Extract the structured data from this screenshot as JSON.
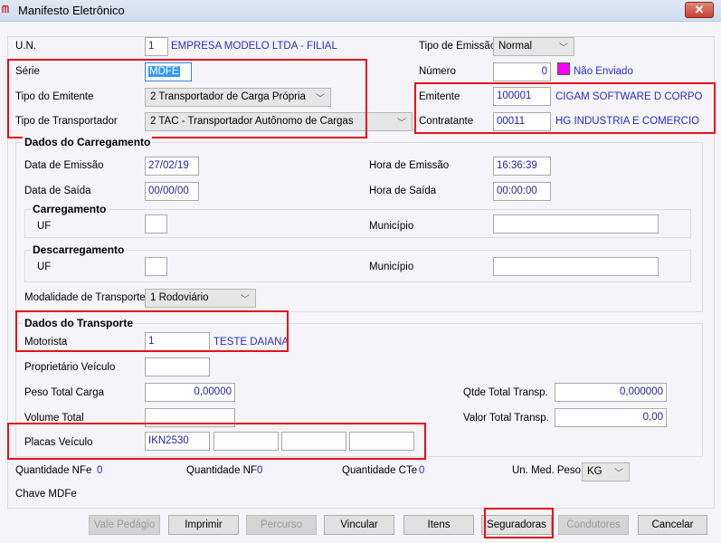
{
  "window": {
    "title": "Manifesto Eletrônico",
    "close": "✕"
  },
  "un": {
    "label": "U.N.",
    "value": "1",
    "name": "EMPRESA MODELO LTDA - FILIAL"
  },
  "serie": {
    "label": "Série",
    "value": "MDFE"
  },
  "tipo_emitente": {
    "label": "Tipo do Emitente",
    "value": "2 Transportador de Carga Própria"
  },
  "tipo_transportador": {
    "label": "Tipo de Transportador",
    "value": "2 TAC - Transportador Autônomo de Cargas"
  },
  "tipo_emissao": {
    "label": "Tipo de Emissão",
    "value": "Normal"
  },
  "numero": {
    "label": "Número",
    "value": "0",
    "status": "Não Enviado",
    "status_color": "#ff00ff"
  },
  "emitente": {
    "label": "Emitente",
    "code": "100001",
    "name": "CIGAM SOFTWARE D CORPORAT."
  },
  "contratante": {
    "label": "Contratante",
    "code": "00011",
    "name": "HG INDUSTRIA E COMERCIO DE C"
  },
  "carregamento": {
    "title": "Dados do Carregamento",
    "data_emissao_label": "Data de Emissão",
    "data_emissao": "27/02/19",
    "hora_emissao_label": "Hora de Emissão",
    "hora_emissao": "16:36:39",
    "data_saida_label": "Data de Saída",
    "data_saida": "00/00/00",
    "hora_saida_label": "Hora de Saída",
    "hora_saida": "00:00:00",
    "carreg": {
      "title": "Carregamento",
      "uf_label": "UF",
      "uf": "",
      "municipio_label": "Município",
      "municipio": ""
    },
    "descarreg": {
      "title": "Descarregamento",
      "uf_label": "UF",
      "uf": "",
      "municipio_label": "Município",
      "municipio": ""
    },
    "modalidade_label": "Modalidade de Transporte",
    "modalidade": "1 Rodoviário"
  },
  "transporte": {
    "title": "Dados do Transporte",
    "motorista_label": "Motorista",
    "motorista_code": "1",
    "motorista_name": "TESTE DAIANA",
    "proprietario_label": "Proprietário Veículo",
    "proprietario": "",
    "peso_label": "Peso Total Carga",
    "peso": "0,00000",
    "qtde_label": "Qtde Total Transp.",
    "qtde": "0,000000",
    "volume_label": "Volume Total",
    "volume": "",
    "valor_label": "Valor Total Transp.",
    "valor": "0,00",
    "placas_label": "Placas Veículo",
    "placas": [
      "IKN2530",
      "",
      "",
      ""
    ]
  },
  "totais": {
    "nfe_label": "Quantidade NFe",
    "nfe": "0",
    "nf_label": "Quantidade NF",
    "nf": "0",
    "cte_label": "Quantidade CTe",
    "cte": "0",
    "unmed_label": "Un. Med. Peso",
    "unmed": "KG",
    "chave_label": "Chave MDFe"
  },
  "buttons": {
    "vale": "Vale Pedágio",
    "imprimir": "Imprimir",
    "percurso": "Percurso",
    "vincular": "Vincular",
    "itens": "Itens",
    "seguradoras": "Seguradoras",
    "condutores": "Condutores",
    "cancelar": "Cancelar"
  }
}
